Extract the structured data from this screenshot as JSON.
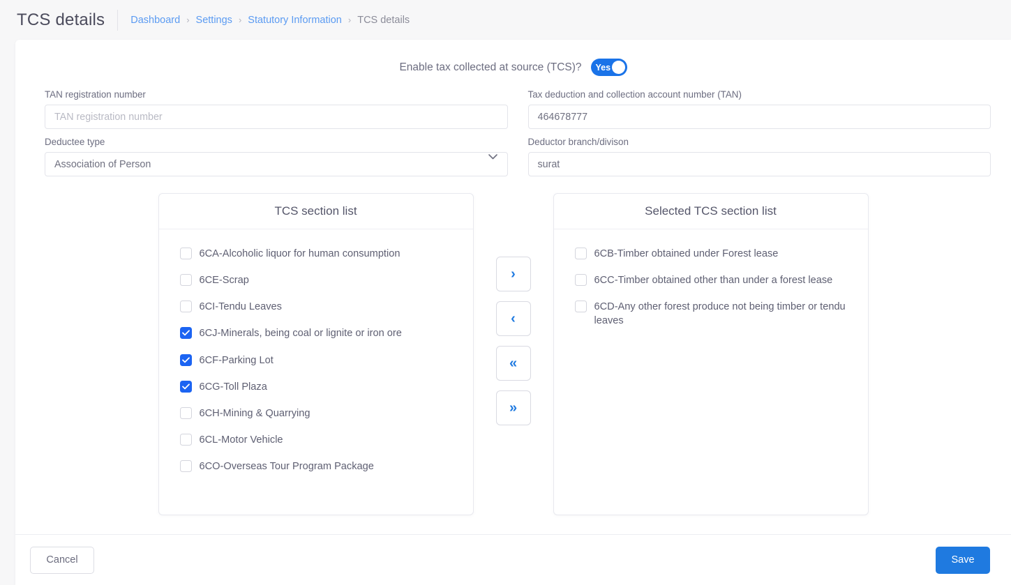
{
  "header": {
    "title": "TCS details",
    "breadcrumb": [
      {
        "label": "Dashboard",
        "current": false
      },
      {
        "label": "Settings",
        "current": false
      },
      {
        "label": "Statutory Information",
        "current": false
      },
      {
        "label": "TCS details",
        "current": true
      }
    ],
    "separator": "›"
  },
  "toggle": {
    "label": "Enable tax collected at source (TCS)?",
    "value": "Yes",
    "on": true,
    "accent_color": "#1a73e8"
  },
  "fields": {
    "tan_registration": {
      "label": "TAN registration number",
      "value": "",
      "placeholder": "TAN registration number"
    },
    "tan_number": {
      "label": "Tax deduction and collection account number (TAN)",
      "value": "464678777",
      "placeholder": "Tax deduction and collection account number (TAN)"
    },
    "deductee_type": {
      "label": "Deductee type",
      "value": "Association of Person",
      "icon": "chevron-down-icon"
    },
    "deductor_branch": {
      "label": "Deductor branch/divison",
      "value": "surat",
      "placeholder": "Deductor branch/divison"
    }
  },
  "available_panel": {
    "title": "TCS section list",
    "items": [
      {
        "label": "6CA-Alcoholic liquor for human consumption",
        "checked": false
      },
      {
        "label": "6CE-Scrap",
        "checked": false
      },
      {
        "label": "6CI-Tendu Leaves",
        "checked": false
      },
      {
        "label": "6CJ-Minerals, being coal or lignite or iron ore",
        "checked": true
      },
      {
        "label": "6CF-Parking Lot",
        "checked": true
      },
      {
        "label": "6CG-Toll Plaza",
        "checked": true
      },
      {
        "label": "6CH-Mining & Quarrying",
        "checked": false
      },
      {
        "label": "6CL-Motor Vehicle",
        "checked": false
      },
      {
        "label": "6CO-Overseas Tour Program Package",
        "checked": false
      }
    ]
  },
  "selected_panel": {
    "title": "Selected TCS section list",
    "items": [
      {
        "label": "6CB-Timber obtained under Forest lease",
        "checked": false
      },
      {
        "label": "6CC-Timber obtained other than under a forest lease",
        "checked": false
      },
      {
        "label": "6CD-Any other forest produce not being timber or tendu leaves",
        "checked": false
      }
    ]
  },
  "transfer_buttons": [
    {
      "glyph": "›",
      "name": "move-right-button"
    },
    {
      "glyph": "‹",
      "name": "move-left-button"
    },
    {
      "glyph": "«",
      "name": "move-all-left-button"
    },
    {
      "glyph": "»",
      "name": "move-all-right-button"
    }
  ],
  "footer": {
    "cancel_label": "Cancel",
    "save_label": "Save",
    "save_color": "#1f7ae0"
  }
}
